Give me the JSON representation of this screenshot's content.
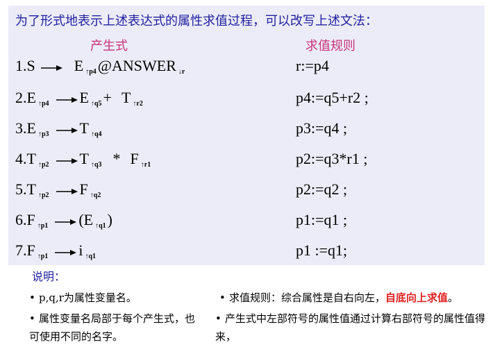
{
  "intro": "为了形式地表示上述表达式的属性求值过程，可以改写上述文法：",
  "headers": {
    "production": "产生式",
    "rule": "求值规则"
  },
  "rows": [
    {
      "parts": [
        {
          "t": "text",
          "v": "1.S"
        },
        {
          "t": "arrow"
        },
        {
          "t": "gap"
        },
        {
          "t": "text",
          "v": "E"
        },
        {
          "t": "sub",
          "v": "↑p4"
        },
        {
          "t": "text",
          "v": "@ANSWER"
        },
        {
          "t": "sub",
          "v": "↓r"
        }
      ],
      "rule": "r:=p4"
    },
    {
      "parts": [
        {
          "t": "text",
          "v": "2.E"
        },
        {
          "t": "sub",
          "v": "↑p4"
        },
        {
          "t": "arrow"
        },
        {
          "t": "text",
          "v": "E"
        },
        {
          "t": "sub",
          "v": "↑q5"
        },
        {
          "t": "text",
          "v": "+"
        },
        {
          "t": "gap"
        },
        {
          "t": "text",
          "v": "T"
        },
        {
          "t": "sub",
          "v": "↑r2"
        }
      ],
      "rule": "p4:=q5+r2 ;"
    },
    {
      "parts": [
        {
          "t": "text",
          "v": "3.E"
        },
        {
          "t": "sub",
          "v": "↑p3"
        },
        {
          "t": "arrow"
        },
        {
          "t": "text",
          "v": "T"
        },
        {
          "t": "sub",
          "v": "↑q4"
        }
      ],
      "rule": "p3:=q4 ;"
    },
    {
      "parts": [
        {
          "t": "text",
          "v": "4.T"
        },
        {
          "t": "sub",
          "v": "↑p2"
        },
        {
          "t": "arrow"
        },
        {
          "t": "text",
          "v": "T"
        },
        {
          "t": "sub",
          "v": "↑q3"
        },
        {
          "t": "gap"
        },
        {
          "t": "text",
          "v": "*"
        },
        {
          "t": "gap"
        },
        {
          "t": "text",
          "v": "F"
        },
        {
          "t": "sub",
          "v": "↑r1"
        }
      ],
      "rule": "p2:=q3*r1 ;"
    },
    {
      "parts": [
        {
          "t": "text",
          "v": "5.T"
        },
        {
          "t": "sub",
          "v": "↑p2"
        },
        {
          "t": "arrow"
        },
        {
          "t": "text",
          "v": "F"
        },
        {
          "t": "sub",
          "v": "↑q2"
        }
      ],
      "rule": "p2:=q2 ;"
    },
    {
      "parts": [
        {
          "t": "text",
          "v": "6.F"
        },
        {
          "t": "sub",
          "v": "↑p1"
        },
        {
          "t": "arrow"
        },
        {
          "t": "text",
          "v": "(E"
        },
        {
          "t": "sub",
          "v": "↑q1"
        },
        {
          "t": "text",
          "v": ")"
        }
      ],
      "rule": "p1:=q1 ;"
    },
    {
      "parts": [
        {
          "t": "text",
          "v": "7.F"
        },
        {
          "t": "sub",
          "v": "↑p1"
        },
        {
          "t": "arrow"
        },
        {
          "t": "text",
          "v": "i"
        },
        {
          "t": "sub",
          "v": "↑q1"
        }
      ],
      "rule": "p1 :=q1;"
    }
  ],
  "notes": {
    "title": "说明：",
    "n1": "p,q,r为属性变量名。",
    "n2": "属性变量名局部于每个产生式，也可使用不同的名字。",
    "n3_prefix": "求值规则：综合属性是自右向左，",
    "n3_emph": "自底向上求值",
    "n3_suffix": "。",
    "n4": "产生式中左部符号的属性值通过计算右部符号的属性值得来，"
  },
  "colors": {
    "panel": "#ececf8",
    "intro": "#2020a0",
    "header": "#c8327a",
    "emphasis": "#e02020"
  }
}
